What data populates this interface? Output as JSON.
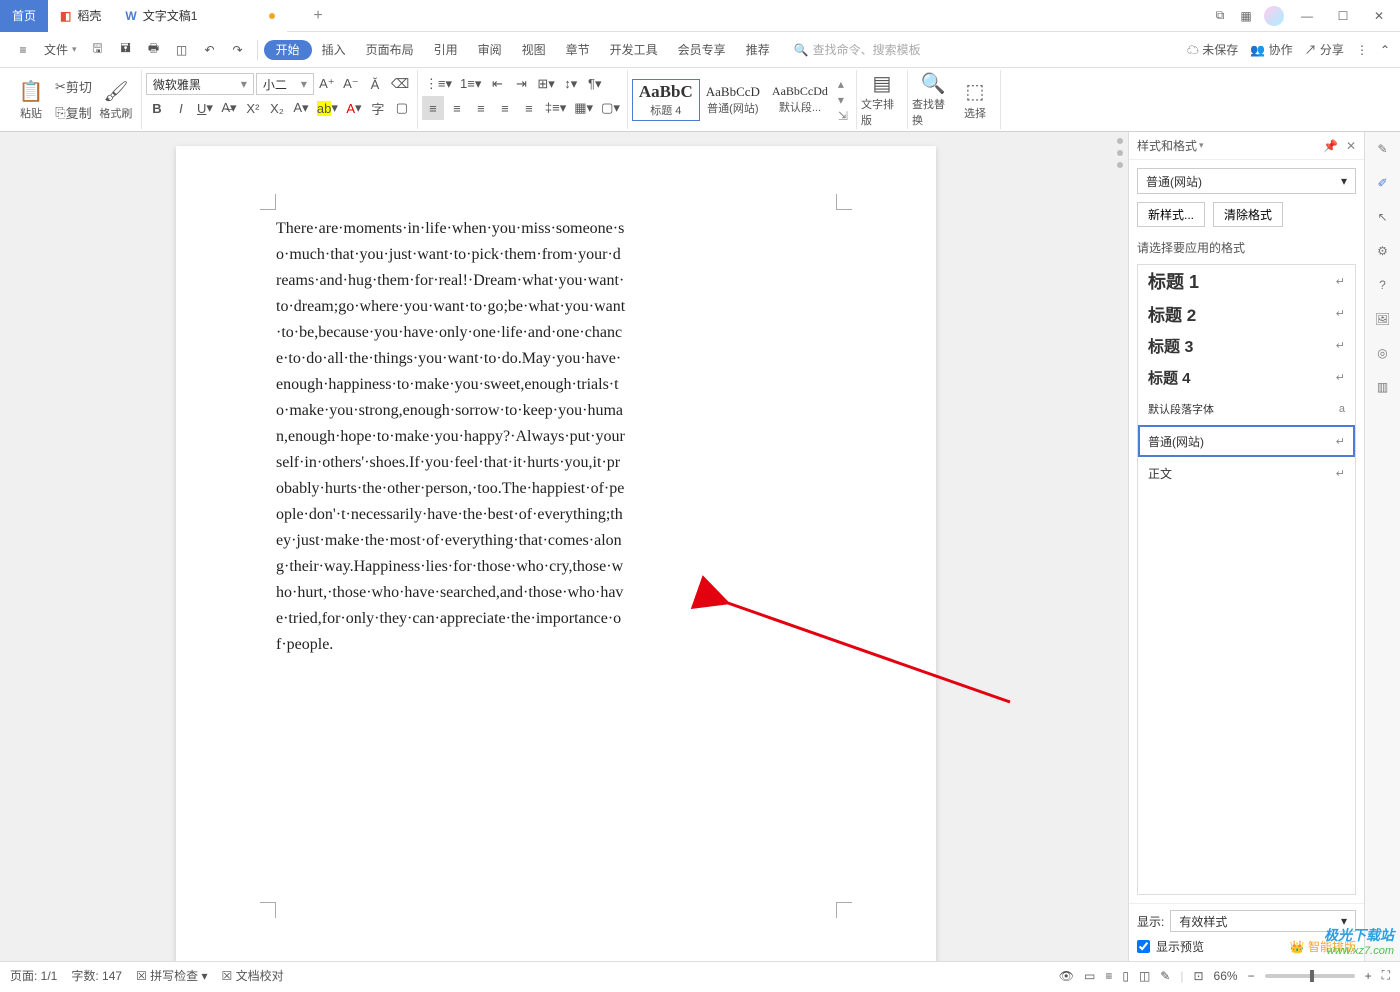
{
  "titlebar": {
    "home": "首页",
    "docker": "稻壳",
    "doc_tab": "文字文稿1"
  },
  "menubar": {
    "file": "文件",
    "tabs": [
      "开始",
      "插入",
      "页面布局",
      "引用",
      "审阅",
      "视图",
      "章节",
      "开发工具",
      "会员专享",
      "推荐"
    ],
    "search_placeholder": "查找命令、搜索模板",
    "unsaved": "未保存",
    "coop": "协作",
    "share": "分享"
  },
  "ribbon": {
    "paste": "粘贴",
    "cut": "剪切",
    "copy": "复制",
    "format_painter": "格式刷",
    "font_name": "微软雅黑",
    "font_size": "小二",
    "style1_preview": "AaBbC",
    "style1_label": "标题 4",
    "style2_preview": "AaBbCcD",
    "style2_label": "普通(网站)",
    "style3_preview": "AaBbCcDd",
    "style3_label": "默认段...",
    "text_layout": "文字排版",
    "find_replace": "查找替换",
    "select": "选择"
  },
  "doc_text": "There·are·moments·in·life·when·you·miss·someone·so·much·that·you·just·want·to·pick·them·from·your·dreams·and·hug·them·for·real!·Dream·what·you·want·to·dream;go·where·you·want·to·go;be·what·you·want·to·be,because·you·have·only·one·life·and·one·chance·to·do·all·the·things·you·want·to·do.May·you·have·enough·happiness·to·make·you·sweet,enough·trials·to·make·you·strong,enough·sorrow·to·keep·you·human,enough·hope·to·make·you·happy?·Always·put·yourself·in·others'·shoes.If·you·feel·that·it·hurts·you,it·probably·hurts·the·other·person,·too.The·happiest·of·people·don'·t·necessarily·have·the·best·of·everything;they·just·make·the·most·of·everything·that·comes·along·their·way.Happiness·lies·for·those·who·cry,those·who·hurt,·those·who·have·searched,and·those·who·have·tried,for·only·they·can·appreciate·the·importance·of·people.",
  "rightpanel": {
    "title": "样式和格式",
    "current_style": "普通(网站)",
    "new_style": "新样式...",
    "clear_format": "清除格式",
    "choose_label": "请选择要应用的格式",
    "styles": [
      {
        "name": "标题 1",
        "cls": "h1"
      },
      {
        "name": "标题 2",
        "cls": "h2"
      },
      {
        "name": "标题 3",
        "cls": "h3"
      },
      {
        "name": "标题 4",
        "cls": "h4"
      },
      {
        "name": "默认段落字体",
        "cls": "small",
        "mark": "a"
      },
      {
        "name": "普通(网站)",
        "cls": "selected"
      },
      {
        "name": "正文",
        "cls": ""
      }
    ],
    "show_label": "显示:",
    "show_value": "有效样式",
    "preview_label": "显示预览",
    "smart_layout": "智能排版"
  },
  "statusbar": {
    "page": "页面: 1/1",
    "words": "字数: 147",
    "spellcheck": "拼写检查",
    "doccheck": "文档校对",
    "zoom": "66%"
  },
  "watermark": {
    "l1": "极光下载站",
    "l2": "www.xz7.com"
  }
}
